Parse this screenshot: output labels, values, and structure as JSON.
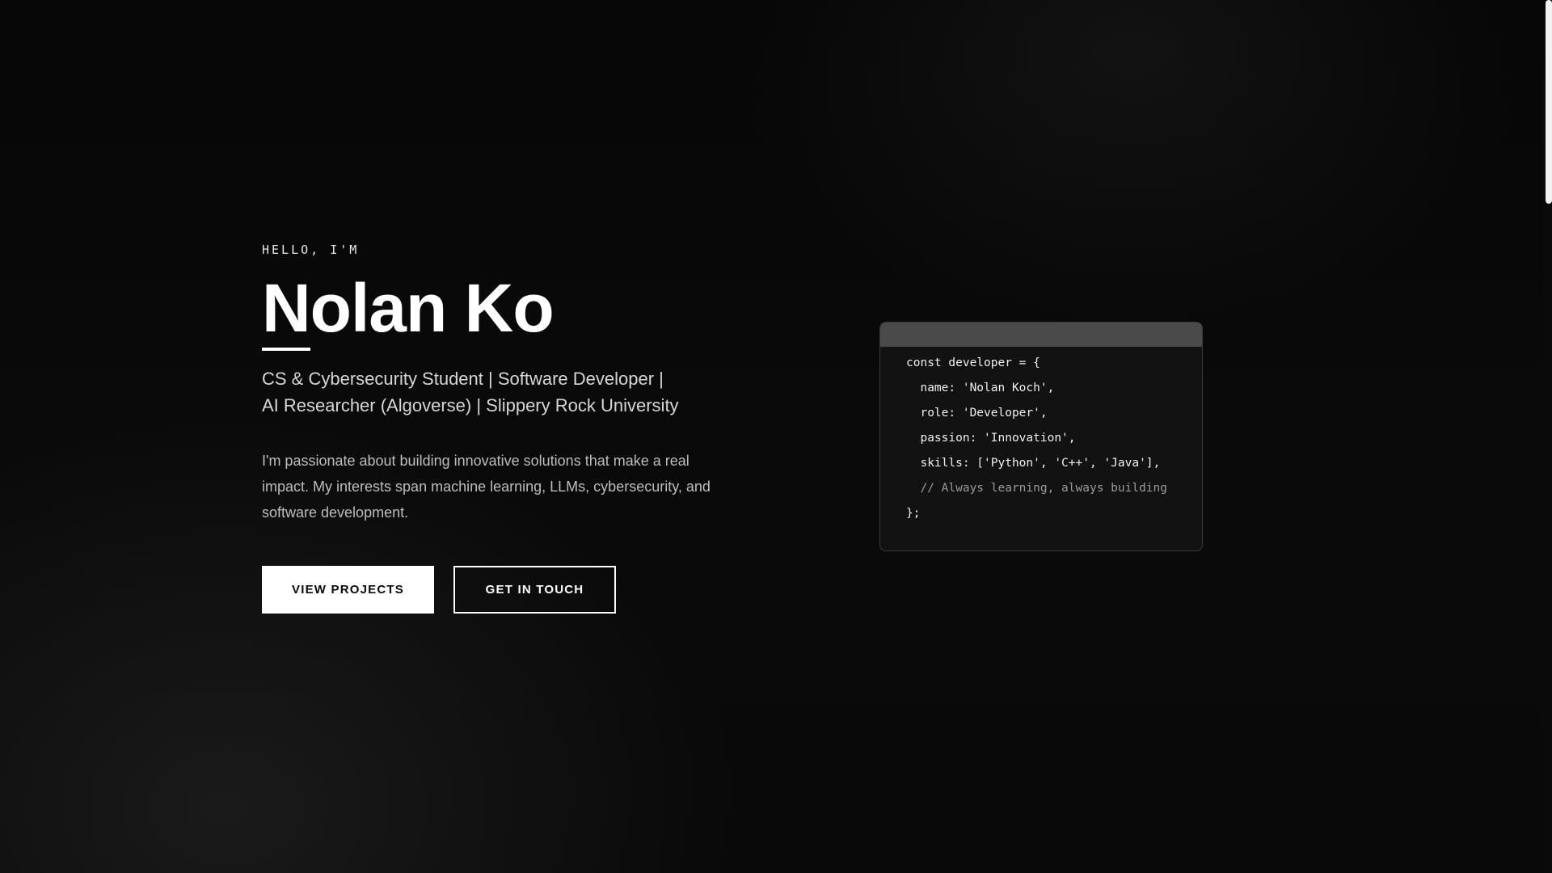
{
  "hero": {
    "greeting": "HELLO, I'M",
    "name": "Nolan Ko",
    "tagline": "CS & Cybersecurity Student | Software Developer | AI Researcher (Algoverse) | Slippery Rock University",
    "bio": "I'm passionate about building innovative solutions that make a real impact. My interests span machine learning, LLMs, cybersecurity, and software development.",
    "buttons": {
      "primary_label": "VIEW PROJECTS",
      "secondary_label": "GET IN TOUCH"
    }
  },
  "code_window": {
    "lines": [
      "const developer = {",
      "  name: 'Nolan Koch',",
      "  role: 'Developer',",
      "  passion: 'Innovation',",
      "  skills: ['Python', 'C++', 'Java'],",
      "  // Always learning, always building",
      "};"
    ]
  },
  "colors": {
    "background": "#050505",
    "accent": "#ffffff",
    "code_titlebar": "#4a4a4a"
  }
}
